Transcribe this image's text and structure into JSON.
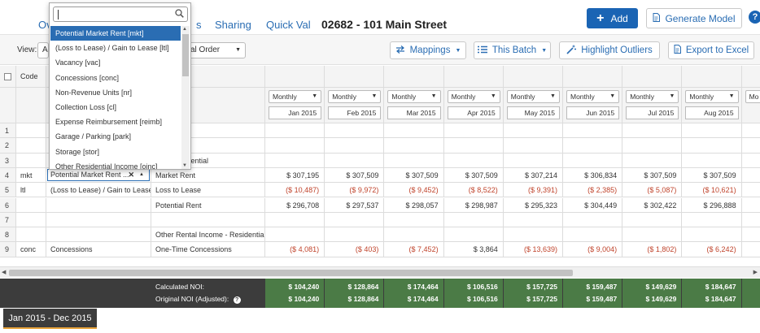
{
  "header": {
    "tab_overview": "Ov",
    "tab_partial": "s",
    "tab_sharing": "Sharing",
    "tab_quickval": "Quick Val",
    "page_title": "02682 - 101 Main Street",
    "add_label": "Add",
    "generate_label": "Generate Model",
    "help_icon": "?"
  },
  "toolbar": {
    "view_label": "View:",
    "view_value": "A",
    "order_value": "al Order",
    "mappings_label": "Mappings",
    "batch_label": "This Batch",
    "highlight_label": "Highlight Outliers",
    "export_label": "Export to Excel"
  },
  "dropdown": {
    "search_value": "",
    "items": [
      "Potential Market Rent [mkt]",
      "(Loss to Lease) / Gain to Lease [ltl]",
      "Vacancy [vac]",
      "Concessions [conc]",
      "Non-Revenue Units [nr]",
      "Collection Loss [cl]",
      "Expense Reimbursement [reimb]",
      "Garage / Parking [park]",
      "Storage [stor]",
      "Other Residential Income [oinc]"
    ],
    "selected_index": 0
  },
  "grid": {
    "code_header": "Code",
    "period_options_label": "Monthly",
    "dates": [
      "Jan 2015",
      "Feb 2015",
      "Mar 2015",
      "Apr 2015",
      "May 2015",
      "Jun 2015",
      "Jul 2015",
      "Aug 2015"
    ],
    "next_col_partial": "Mo",
    "rows": [
      {
        "num": "1",
        "code": "",
        "mapping": "",
        "label": "",
        "values": [
          "",
          "",
          "",
          "",
          "",
          "",
          "",
          ""
        ]
      },
      {
        "num": "2",
        "code": "",
        "mapping": "",
        "label": "",
        "values": [
          "",
          "",
          "",
          "",
          "",
          "",
          "",
          ""
        ]
      },
      {
        "num": "3",
        "code": "",
        "mapping": "",
        "label": "me - Residential",
        "values": [
          "",
          "",
          "",
          "",
          "",
          "",
          "",
          ""
        ]
      },
      {
        "num": "4",
        "code": "mkt",
        "mapping": "Potential Market Rent ...",
        "label": "Market Rent",
        "values": [
          "$ 307,195",
          "$ 307,509",
          "$ 307,509",
          "$ 307,509",
          "$ 307,214",
          "$ 306,834",
          "$ 307,509",
          "$ 307,509"
        ]
      },
      {
        "num": "5",
        "code": "ltl",
        "mapping": "(Loss to Lease) / Gain to Lease",
        "label": "Loss to Lease",
        "values": [
          "($ 10,487)",
          "($ 9,972)",
          "($ 9,452)",
          "($ 8,522)",
          "($ 9,391)",
          "($ 2,385)",
          "($ 5,087)",
          "($ 10,621)"
        ]
      },
      {
        "num": "6",
        "code": "",
        "mapping": "",
        "label": "Potential Rent",
        "values": [
          "$ 296,708",
          "$ 297,537",
          "$ 298,057",
          "$ 298,987",
          "$ 295,323",
          "$ 304,449",
          "$ 302,422",
          "$ 296,888"
        ]
      },
      {
        "num": "7",
        "code": "",
        "mapping": "",
        "label": "",
        "values": [
          "",
          "",
          "",
          "",
          "",
          "",
          "",
          ""
        ]
      },
      {
        "num": "8",
        "code": "",
        "mapping": "",
        "label": "Other Rental Income - Residential",
        "values": [
          "",
          "",
          "",
          "",
          "",
          "",
          "",
          ""
        ]
      },
      {
        "num": "9",
        "code": "conc",
        "mapping": "Concessions",
        "label": "One-Time Concessions",
        "values": [
          "($ 4,081)",
          "($ 403)",
          "($ 7,452)",
          "$ 3,864",
          "($ 13,639)",
          "($ 9,004)",
          "($ 1,802)",
          "($ 6,242)"
        ]
      }
    ]
  },
  "footer": {
    "calc_label": "Calculated NOI:",
    "orig_label": "Original NOI (Adjusted):",
    "calc_values": [
      "$ 104,240",
      "$ 128,864",
      "$ 174,464",
      "$ 106,516",
      "$ 157,725",
      "$ 159,487",
      "$ 149,629",
      "$ 184,647"
    ],
    "orig_values": [
      "$ 104,240",
      "$ 128,864",
      "$ 174,464",
      "$ 106,516",
      "$ 157,725",
      "$ 159,487",
      "$ 149,629",
      "$ 184,647"
    ],
    "period_tab": "Jan 2015 - Dec 2015"
  },
  "colors": {
    "accent": "#1a64b4",
    "negative": "#c0442c",
    "footer_dark": "#3c3c3c",
    "footer_green": "#4b7b46",
    "period_underline": "#e8a33a"
  }
}
